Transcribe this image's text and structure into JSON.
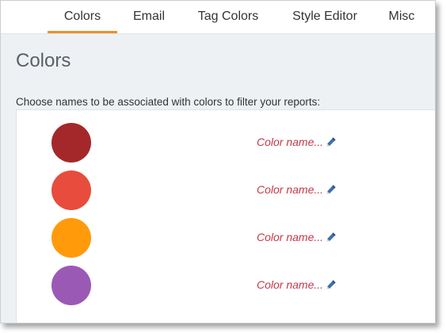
{
  "tabs": [
    {
      "label": "Colors",
      "active": true
    },
    {
      "label": "Email",
      "active": false
    },
    {
      "label": "Tag Colors",
      "active": false
    },
    {
      "label": "Style Editor",
      "active": false
    },
    {
      "label": "Misc",
      "active": false
    }
  ],
  "accent_color": "#e8922a",
  "page": {
    "title": "Colors",
    "instruction": "Choose names to be associated with colors to filter your reports:"
  },
  "colors": [
    {
      "swatch": "#a4282a",
      "placeholder": "Color name...",
      "icon": "pencil-icon"
    },
    {
      "swatch": "#e84c3d",
      "placeholder": "Color name...",
      "icon": "pencil-icon"
    },
    {
      "swatch": "#ff9a0b",
      "placeholder": "Color name...",
      "icon": "pencil-icon"
    },
    {
      "swatch": "#9b59b6",
      "placeholder": "Color name...",
      "icon": "pencil-icon"
    }
  ],
  "placeholder_color": "#c3384a"
}
